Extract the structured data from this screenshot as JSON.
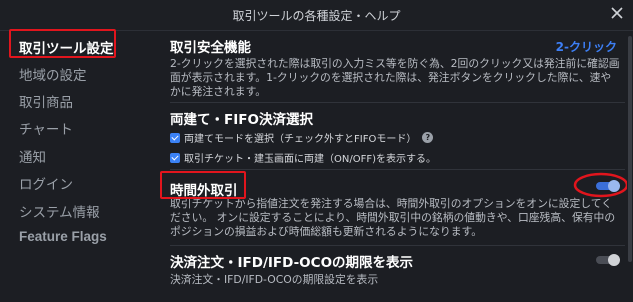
{
  "window": {
    "title": "取引ツールの各種設定・ヘルプ"
  },
  "sidebar": {
    "items": [
      {
        "label": "取引ツール設定",
        "active": true
      },
      {
        "label": "地域の設定"
      },
      {
        "label": "取引商品"
      },
      {
        "label": "チャート"
      },
      {
        "label": "通知"
      },
      {
        "label": "ログイン"
      },
      {
        "label": "システム情報"
      },
      {
        "label": "Feature Flags"
      }
    ]
  },
  "sections": {
    "safety": {
      "title": "取引安全機能",
      "value": "2-クリック",
      "description": "2-クリックを選択された際は取引の入力ミス等を防ぐ為、2回のクリック又は発注前に確認画面が表示されます。1-クリックのを選択された際は、発注ボタンをクリックした際に、速やかに発注されます。"
    },
    "fifo": {
      "title": "両建て・FIFO決済選択",
      "options": [
        {
          "label": "両建てモードを選択（チェック外すとFIFOモード）",
          "checked": true,
          "help": "?"
        },
        {
          "label": "取引チケット・建玉画面に両建（ON/OFF)を表示する。",
          "checked": true
        }
      ]
    },
    "after_hours": {
      "title": "時間外取引",
      "enabled": true,
      "description": "取引チケットから指値注文を発注する場合は、時間外取引のオプションをオンに設定してください。 オンに設定することにより、時間外取引中の銘柄の値動きや、口座残高、保有中のポジションの損益および時価総額も更新されるようになります。"
    },
    "expiry": {
      "title": "決済注文・IFD/IFD-OCOの期限を表示",
      "enabled": false,
      "description": "決済注文・IFD/IFD-OCOの期限設定を表示"
    }
  },
  "colors": {
    "accent": "#3d7ff5",
    "highlight": "#e1151d",
    "background": "#1c1e23"
  },
  "icons": {
    "close": "close-icon",
    "help": "help-icon",
    "check": "checkbox-icon"
  }
}
